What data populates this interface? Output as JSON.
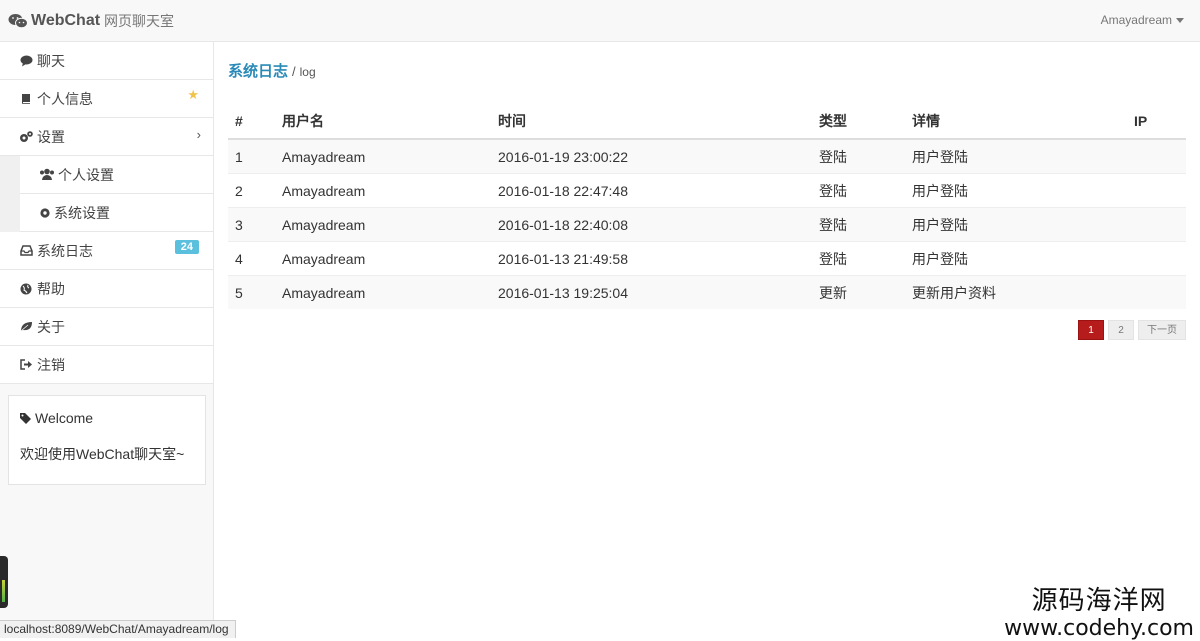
{
  "navbar": {
    "brand_name": "WebChat",
    "brand_sub": "网页聊天室",
    "user_name": "Amayadream"
  },
  "sidebar": {
    "items": [
      {
        "label": "聊天",
        "icon": "comment-icon"
      },
      {
        "label": "个人信息",
        "icon": "book-icon"
      },
      {
        "label": "设置",
        "icon": "cogs-icon"
      },
      {
        "label": "系统日志",
        "icon": "inbox-icon",
        "badge": "24"
      },
      {
        "label": "帮助",
        "icon": "globe-icon"
      },
      {
        "label": "关于",
        "icon": "leaf-icon"
      },
      {
        "label": "注销",
        "icon": "sign-out-icon"
      }
    ],
    "settings_sub": [
      {
        "label": "个人设置",
        "icon": "users-icon"
      },
      {
        "label": "系统设置",
        "icon": "cog-icon"
      }
    ],
    "welcome": {
      "title": "Welcome",
      "body": "欢迎使用WebChat聊天室~"
    }
  },
  "breadcrumb": {
    "main": "系统日志",
    "separator": "/",
    "sub": "log"
  },
  "table": {
    "headers": [
      "#",
      "用户名",
      "时间",
      "类型",
      "详情",
      "IP"
    ],
    "rows": [
      [
        "1",
        "Amayadream",
        "2016-01-19 23:00:22",
        "登陆",
        "用户登陆",
        ""
      ],
      [
        "2",
        "Amayadream",
        "2016-01-18 22:47:48",
        "登陆",
        "用户登陆",
        ""
      ],
      [
        "3",
        "Amayadream",
        "2016-01-18 22:40:08",
        "登陆",
        "用户登陆",
        ""
      ],
      [
        "4",
        "Amayadream",
        "2016-01-13 21:49:58",
        "登陆",
        "用户登陆",
        ""
      ],
      [
        "5",
        "Amayadream",
        "2016-01-13 19:25:04",
        "更新",
        "更新用户资料",
        ""
      ]
    ]
  },
  "pagination": {
    "pages": [
      "1",
      "2"
    ],
    "active": "1",
    "next_label": "下一页"
  },
  "status_url": "localhost:8089/WebChat/Amayadream/log",
  "watermark": {
    "cn": "源码海洋网",
    "url": "www.codehy.com"
  },
  "colors": {
    "accent": "#2a8ab7",
    "badge": "#5bc0de",
    "active_page": "#b71c1c"
  }
}
